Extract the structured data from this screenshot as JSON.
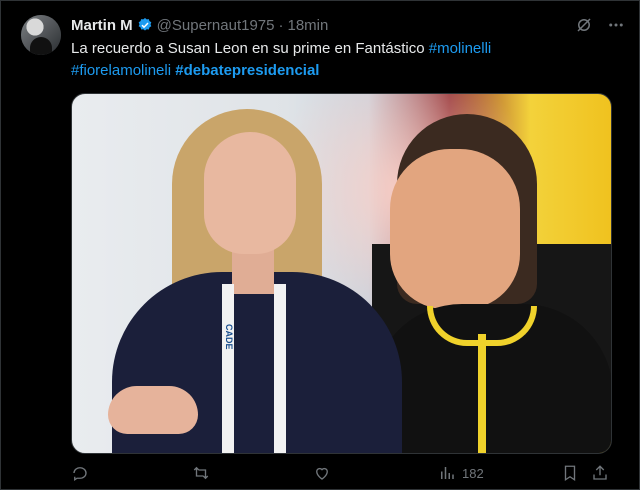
{
  "tweet": {
    "author_name": "Martin M",
    "handle": "@Supernaut1975",
    "separator": "·",
    "time": "18min",
    "text": "La recuerdo a Susan Leon en su prime en Fantástico ",
    "hashtags": [
      "#molinelli",
      "#fiorelamolineli",
      "#debatepresidencial"
    ]
  },
  "media": {
    "lanyard_text": "CADE"
  },
  "actions": {
    "views": "182"
  },
  "colors": {
    "background": "#000000",
    "text": "#e7e9ea",
    "muted": "#71767b",
    "link": "#1d9bf0",
    "verified": "#1d9bf0"
  },
  "icons": [
    "verified-badge-icon",
    "grok-icon",
    "more-icon",
    "reply-icon",
    "retweet-icon",
    "like-icon",
    "views-icon",
    "bookmark-icon",
    "share-icon"
  ]
}
